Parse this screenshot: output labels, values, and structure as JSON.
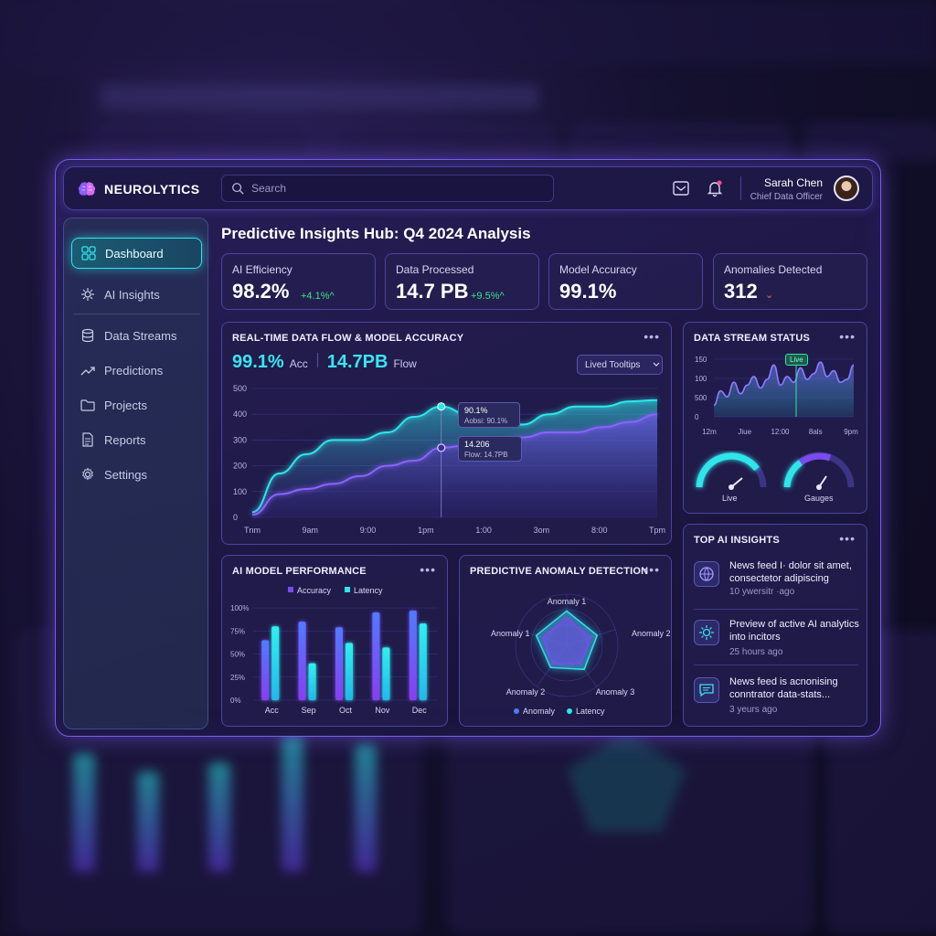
{
  "brand": {
    "name": "NEUROLYTICS"
  },
  "search": {
    "placeholder": "Search"
  },
  "user": {
    "name": "Sarah Chen",
    "role": "Chief Data Officer"
  },
  "sidebar": {
    "items": [
      {
        "label": "Dashboard",
        "icon": "grid-icon",
        "active": true
      },
      {
        "label": "AI Insights",
        "icon": "sparkle-gear-icon"
      },
      {
        "label": "Data Streams",
        "icon": "database-icon"
      },
      {
        "label": "Predictions",
        "icon": "trend-icon"
      },
      {
        "label": "Projects",
        "icon": "folder-icon"
      },
      {
        "label": "Reports",
        "icon": "document-icon"
      },
      {
        "label": "Settings",
        "icon": "gear-icon"
      }
    ]
  },
  "page": {
    "title": "Predictive Insights Hub: Q4 2024 Analysis"
  },
  "stats": [
    {
      "label": "AI Efficiency",
      "value": "98.2%",
      "delta": "+4.1%^"
    },
    {
      "label": "Data Processed",
      "value": "14.7 PB",
      "delta": "+9.5%^"
    },
    {
      "label": "Model Accuracy",
      "value": "99.1%",
      "delta": ""
    },
    {
      "label": "Anomalies Detected",
      "value": "312",
      "delta": "⌄"
    }
  ],
  "flow_card": {
    "title": "REAL-TIME DATA FLOW & MODEL ACCURACY",
    "acc_value": "99.1%",
    "acc_label": "Acc",
    "flow_value": "14.7PB",
    "flow_label": "Flow",
    "select": "Lived Tooltips",
    "tooltip1": {
      "value": "90.1%",
      "detail": "Aobsi: 90.1%"
    },
    "tooltip2": {
      "value": "14.206",
      "detail": "Flow: 14.7PB"
    }
  },
  "stream_card": {
    "title": "DATA STREAM STATUS",
    "live_tag": "Live",
    "gauge1": "Live",
    "gauge2": "Gauges"
  },
  "perf_card": {
    "title": "AI MODEL PERFORMANCE"
  },
  "anomaly_card": {
    "title": "PREDICTIVE ANOMALY DETECTION"
  },
  "insights_card": {
    "title": "TOP AI INSIGHTS",
    "items": [
      {
        "text": "News feed I· dolor sit amet, consectetor adipiscing",
        "age": "10 ywersitr ·ago",
        "icon": "globe-icon"
      },
      {
        "text": "Preview of active AI analytics into incitors",
        "age": "25 hours ago",
        "icon": "sun-icon"
      },
      {
        "text": "News feed is acnonising conntrator data-stats...",
        "age": "3 yeurs ago",
        "icon": "message-icon"
      }
    ]
  },
  "colors": {
    "accent": "#2ee6ea",
    "purple": "#7b5cf0",
    "cyan_bar": "#2ee6ea",
    "violet_bar": "#7a4bf0"
  },
  "chart_data": [
    {
      "type": "area",
      "x_ticks": [
        "Tnm",
        "9am",
        "9:00",
        "1pm",
        "1:00",
        "3om",
        "8:00",
        "Tpm"
      ],
      "ylim": [
        0,
        500
      ],
      "y_ticks": [
        "0",
        "100",
        "200",
        "300",
        "400",
        "500"
      ],
      "series": [
        {
          "values": [
            20,
            170,
            245,
            300,
            300,
            330,
            390,
            430,
            400,
            410,
            360,
            400,
            430,
            430,
            450,
            455
          ]
        },
        {
          "values": [
            10,
            90,
            110,
            130,
            160,
            200,
            220,
            270,
            280,
            280,
            310,
            330,
            330,
            350,
            370,
            400
          ]
        }
      ]
    },
    {
      "type": "line",
      "x_ticks": [
        "12m",
        "Jiue",
        "12:00",
        "8als",
        "9pm"
      ],
      "y_ticks": [
        "150",
        "100",
        "500",
        "0"
      ],
      "values": [
        20,
        45,
        35,
        60,
        40,
        55,
        70,
        50,
        65,
        90,
        55,
        70,
        60,
        85,
        65,
        75,
        95,
        70,
        80,
        60,
        65,
        90
      ]
    },
    {
      "type": "bar",
      "categories": [
        "Acc",
        "Sep",
        "Oct",
        "Nov",
        "Dec"
      ],
      "ylim": [
        0,
        100
      ],
      "y_ticks": [
        "0%",
        "25%",
        "50%",
        "75%",
        "100%"
      ],
      "series": [
        {
          "name": "Accuracy",
          "values": [
            65,
            85,
            79,
            95,
            97
          ]
        },
        {
          "name": "Latency",
          "values": [
            80,
            40,
            62,
            57,
            83
          ]
        }
      ]
    },
    {
      "type": "radar",
      "axes": [
        "Anomaly 1",
        "Anomaly 2",
        "Anomaly 3",
        "Anomaly 2",
        "Anomaly 1"
      ],
      "series": [
        {
          "name": "Anomaly",
          "values": [
            0.75,
            0.7,
            0.65,
            0.6,
            0.7
          ]
        },
        {
          "name": "Latency",
          "values": [
            0.6,
            0.55,
            0.5,
            0.5,
            0.55
          ]
        }
      ]
    }
  ]
}
